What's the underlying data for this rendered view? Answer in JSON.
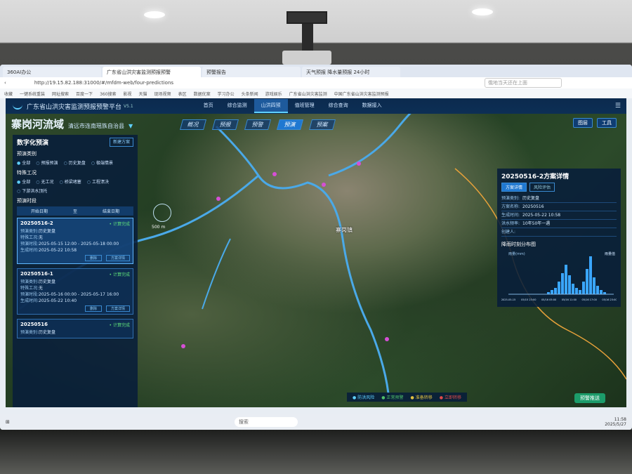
{
  "browser": {
    "tabs": [
      "360AI办公",
      "广东省山洪灾害监测预报预警",
      "预警报告",
      "天气预报 降水量预报 24小时"
    ],
    "url": "http://19.15.82.188:31000/#/mfdm-web/four-predictions",
    "search_placeholder": "俄地当天还在上面",
    "bookmarks": [
      "收藏",
      "一键系统重装",
      "网址搜索",
      "百度一下",
      "360搜索",
      "影视",
      "天猫",
      "现场视频",
      "表区",
      "数据优案",
      "学习办公",
      "头条新闻",
      "游戏娱乐",
      "广东省山洪灾害监测",
      "中国广东省山洪灾害监测预报"
    ]
  },
  "app": {
    "title": "广东省山洪灾害监测预报预警平台",
    "version": "V5.1",
    "nav": [
      "首页",
      "综合监测",
      "山洪四预",
      "值班管理",
      "综合查询",
      "数据接入"
    ],
    "nav_active": 2,
    "menu_icon": "menu-icon"
  },
  "basin": {
    "name": "寨岗河流域",
    "county": "清远市连南瑶族自治县",
    "caret": "▼"
  },
  "stages": [
    "概况",
    "预报",
    "预警",
    "预演",
    "预案"
  ],
  "stage_active": 3,
  "tools": {
    "layers": "图层",
    "tools": "工具"
  },
  "left": {
    "title": "数字化预演",
    "new_button": "新建方案",
    "type_label": "预演类别",
    "type_options": [
      "全部",
      "预报预演",
      "历史复盘",
      "极端情景"
    ],
    "cond_label": "特殊工况",
    "cond_options": [
      "全部",
      "无工况",
      "桥梁堵塞",
      "工程溃决",
      "下游洪水顶托"
    ],
    "time_label": "预演时段",
    "start_date": "开始日期",
    "to": "至",
    "end_date": "结束日期",
    "cards": [
      {
        "name": "20250516-2",
        "status": "• 计算完成",
        "type_k": "预演类别:",
        "type_v": "历史复盘",
        "cond_k": "特殊工况:",
        "cond_v": "无",
        "range_k": "预演时段:",
        "range_v": "2025-05-15 12:00 - 2025-05-18 00:00",
        "gen_k": "生成时间:",
        "gen_v": "2025-05-22 10:58",
        "btn1": "删除",
        "btn2": "方案详情"
      },
      {
        "name": "20250516-1",
        "status": "• 计算完成",
        "type_k": "预演类别:",
        "type_v": "历史复盘",
        "cond_k": "特殊工况:",
        "cond_v": "无",
        "range_k": "预演时段:",
        "range_v": "2025-05-16 00:00 - 2025-05-17 16:00",
        "gen_k": "生成时间:",
        "gen_v": "2025-05-22 10:40",
        "btn1": "删除",
        "btn2": "方案详情"
      },
      {
        "name": "20250516",
        "status": "• 计算完成",
        "type_k": "预演类别:",
        "type_v": "历史复盘"
      }
    ]
  },
  "right": {
    "title": "20250516-2方案详情",
    "tabs": [
      "方案详情",
      "风险评估"
    ],
    "rows": [
      {
        "k": "预演类别:",
        "v": "历史复盘"
      },
      {
        "k": "方案名称:",
        "v": "20250516"
      },
      {
        "k": "生成时间:",
        "v": "2025-05-22 10:58"
      },
      {
        "k": "洪水频率:",
        "v": "10年50年一遇"
      },
      {
        "k": "创建人:",
        "v": ""
      }
    ],
    "chart_title": "降雨时刻分布图",
    "legend": "雨量值"
  },
  "chart_data": {
    "type": "bar",
    "title": "降雨时刻分布图",
    "ylabel": "雨量(mm)",
    "x_ticks": [
      "2025-05-15",
      "05/15 23:00",
      "05/16 05:00",
      "05/16 11:00",
      "05/16 17:00",
      "05/16 23:00"
    ],
    "values": [
      0,
      0,
      0,
      0,
      0,
      0,
      0,
      0,
      0,
      0,
      0,
      1,
      2,
      3,
      6,
      10,
      14,
      9,
      5,
      3,
      2,
      6,
      12,
      18,
      8,
      4,
      2,
      1,
      0,
      0
    ]
  },
  "map": {
    "town": "寨岗镇",
    "scale": "500 m",
    "legend": [
      "防洪风险",
      "正常预警",
      "准备转移",
      "立即转移"
    ],
    "legend_colors": [
      "#5fd0ff",
      "#4fc06a",
      "#e0c040",
      "#e04a4a"
    ],
    "push_button": "预警推送"
  },
  "taskbar": {
    "search": "搜索",
    "time": "11:58",
    "date": "2025/5/27"
  }
}
